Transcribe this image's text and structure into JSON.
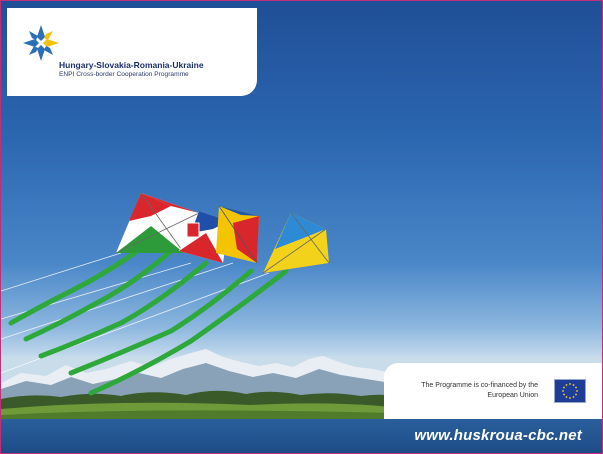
{
  "programme": {
    "title": "Hungary-Slovakia-Romania-Ukraine",
    "subtitle": "ENPI Cross-border Cooperation Programme"
  },
  "eu_notice": {
    "line1": "The Programme is co-financed by the",
    "line2": "European Union"
  },
  "footer": {
    "url": "www.huskroua-cbc.net"
  },
  "colors": {
    "logo_blue": "#2b6fb6",
    "logo_yellow": "#f4c20d",
    "footer_blue": "#1d4c86",
    "eu_blue": "#1e3d99",
    "eu_star": "#ffd21f"
  },
  "icons": {
    "logo": "star-logo-icon",
    "eu_flag": "eu-flag-icon"
  }
}
